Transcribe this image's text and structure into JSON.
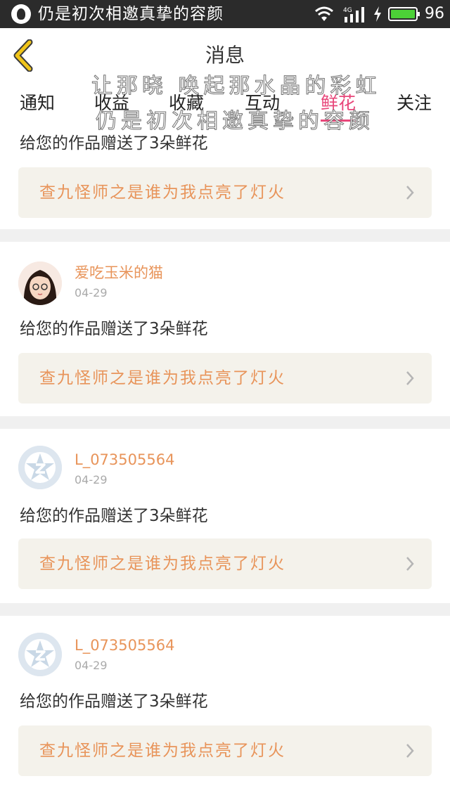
{
  "status_bar": {
    "notification_text": "仍是初次相邀真挚的容颜",
    "network_label": "4G",
    "battery_level": "96"
  },
  "header": {
    "title": "消息"
  },
  "overlay": {
    "line1": "让那晓 唤起那水晶的彩虹",
    "line2": "仍是初次相邀真挚的容颜"
  },
  "tabs": [
    {
      "label": "通知",
      "active": false
    },
    {
      "label": "收益",
      "active": false
    },
    {
      "label": "收藏",
      "active": false
    },
    {
      "label": "互动",
      "active": false
    },
    {
      "label": "鲜花",
      "active": true
    },
    {
      "label": "关注",
      "active": false
    }
  ],
  "notifications": [
    {
      "gift_text": "给您的作品赠送了3朵鲜花",
      "work_title": "查九怪师之是谁为我点亮了灯火"
    },
    {
      "avatar": "girl-avatar",
      "username": "爱吃玉米的猫",
      "time": "04-29",
      "gift_text": "给您的作品赠送了3朵鲜花",
      "work_title": "查九怪师之是谁为我点亮了灯火"
    },
    {
      "avatar": "qq-default-avatar",
      "username": "L_073505564",
      "time": "04-29",
      "gift_text": "给您的作品赠送了3朵鲜花",
      "work_title": "查九怪师之是谁为我点亮了灯火"
    },
    {
      "avatar": "qq-default-avatar",
      "username": "L_073505564",
      "time": "04-29",
      "gift_text": "给您的作品赠送了3朵鲜花",
      "work_title": "查九怪师之是谁为我点亮了灯火"
    }
  ],
  "colors": {
    "accent_pink": "#e8477a",
    "orange_text": "#e8945a",
    "back_arrow": "#f0c419",
    "battery_green": "#4cd137"
  }
}
